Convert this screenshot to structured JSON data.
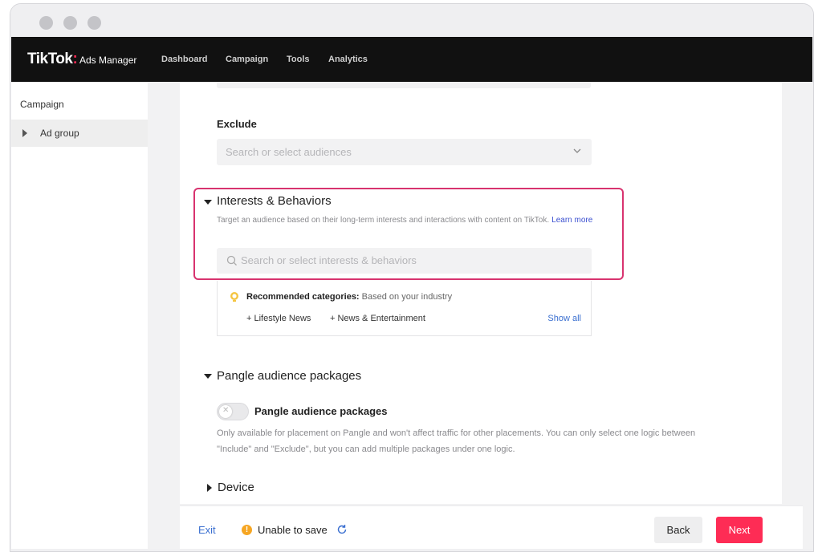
{
  "brand": {
    "logo_text": "TikTok",
    "logo_dot": ":",
    "product": "Ads Manager",
    "accent": "#fe2c55"
  },
  "nav": {
    "items": [
      "Dashboard",
      "Campaign",
      "Tools",
      "Analytics"
    ]
  },
  "sidebar": {
    "items": [
      {
        "label": "Campaign"
      },
      {
        "label": "Ad group",
        "expand_icon": "play-right-icon"
      }
    ]
  },
  "exclude": {
    "label": "Exclude",
    "placeholder": "Search or select audiences"
  },
  "interests": {
    "title": "Interests & Behaviors",
    "description": "Target an audience based on their long-term interests and interactions with content on TikTok.",
    "learn_more": "Learn more",
    "search_placeholder": "Search or select interests & behaviors",
    "highlight_color": "#d8336f",
    "recommended": {
      "label": "Recommended categories:",
      "sub": "Based on your industry",
      "chips": [
        "Lifestyle News",
        "News & Entertainment"
      ],
      "show_all": "Show all"
    }
  },
  "pangle": {
    "title": "Pangle audience packages",
    "toggle_label": "Pangle audience packages",
    "toggle_on": false,
    "description": "Only available for placement on Pangle and won't affect traffic for other placements. You can only select one logic between \"Include\" and \"Exclude\", but you can add multiple packages under one logic."
  },
  "device": {
    "title": "Device"
  },
  "footer": {
    "exit": "Exit",
    "status": "Unable to save",
    "back": "Back",
    "next": "Next"
  }
}
